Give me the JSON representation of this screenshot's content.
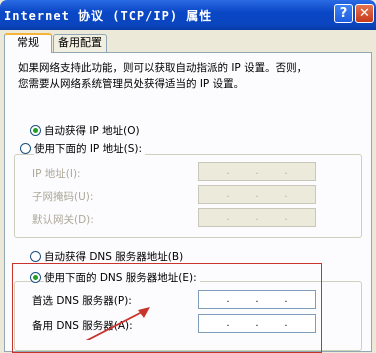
{
  "window": {
    "title": "Internet 协议 (TCP/IP) 属性",
    "help_button": "?",
    "close_button": "✕"
  },
  "tabs": [
    {
      "label": "常规",
      "active": true
    },
    {
      "label": "备用配置",
      "active": false
    }
  ],
  "description": {
    "line1": "如果网络支持此功能，则可以获取自动指派的 IP 设置。否则，",
    "line2": "您需要从网络系统管理员处获得适当的 IP 设置。"
  },
  "ip_section": {
    "auto_label": "自动获得 IP 地址(O)",
    "manual_label": "使用下面的 IP 地址(S):",
    "selected": "auto",
    "fields": [
      {
        "label": "IP 地址(I):",
        "value": ""
      },
      {
        "label": "子网掩码(U):",
        "value": ""
      },
      {
        "label": "默认网关(D):",
        "value": ""
      }
    ]
  },
  "dns_section": {
    "auto_label": "自动获得 DNS 服务器地址(B)",
    "manual_label": "使用下面的 DNS 服务器地址(E):",
    "selected": "manual",
    "fields": [
      {
        "label": "首选 DNS 服务器(P):",
        "value": ""
      },
      {
        "label": "备用 DNS 服务器(A):",
        "value": ""
      }
    ]
  },
  "colors": {
    "titlebar": "#0a47c6",
    "annotation": "#c8342b",
    "radio_dot": "#21a121"
  }
}
